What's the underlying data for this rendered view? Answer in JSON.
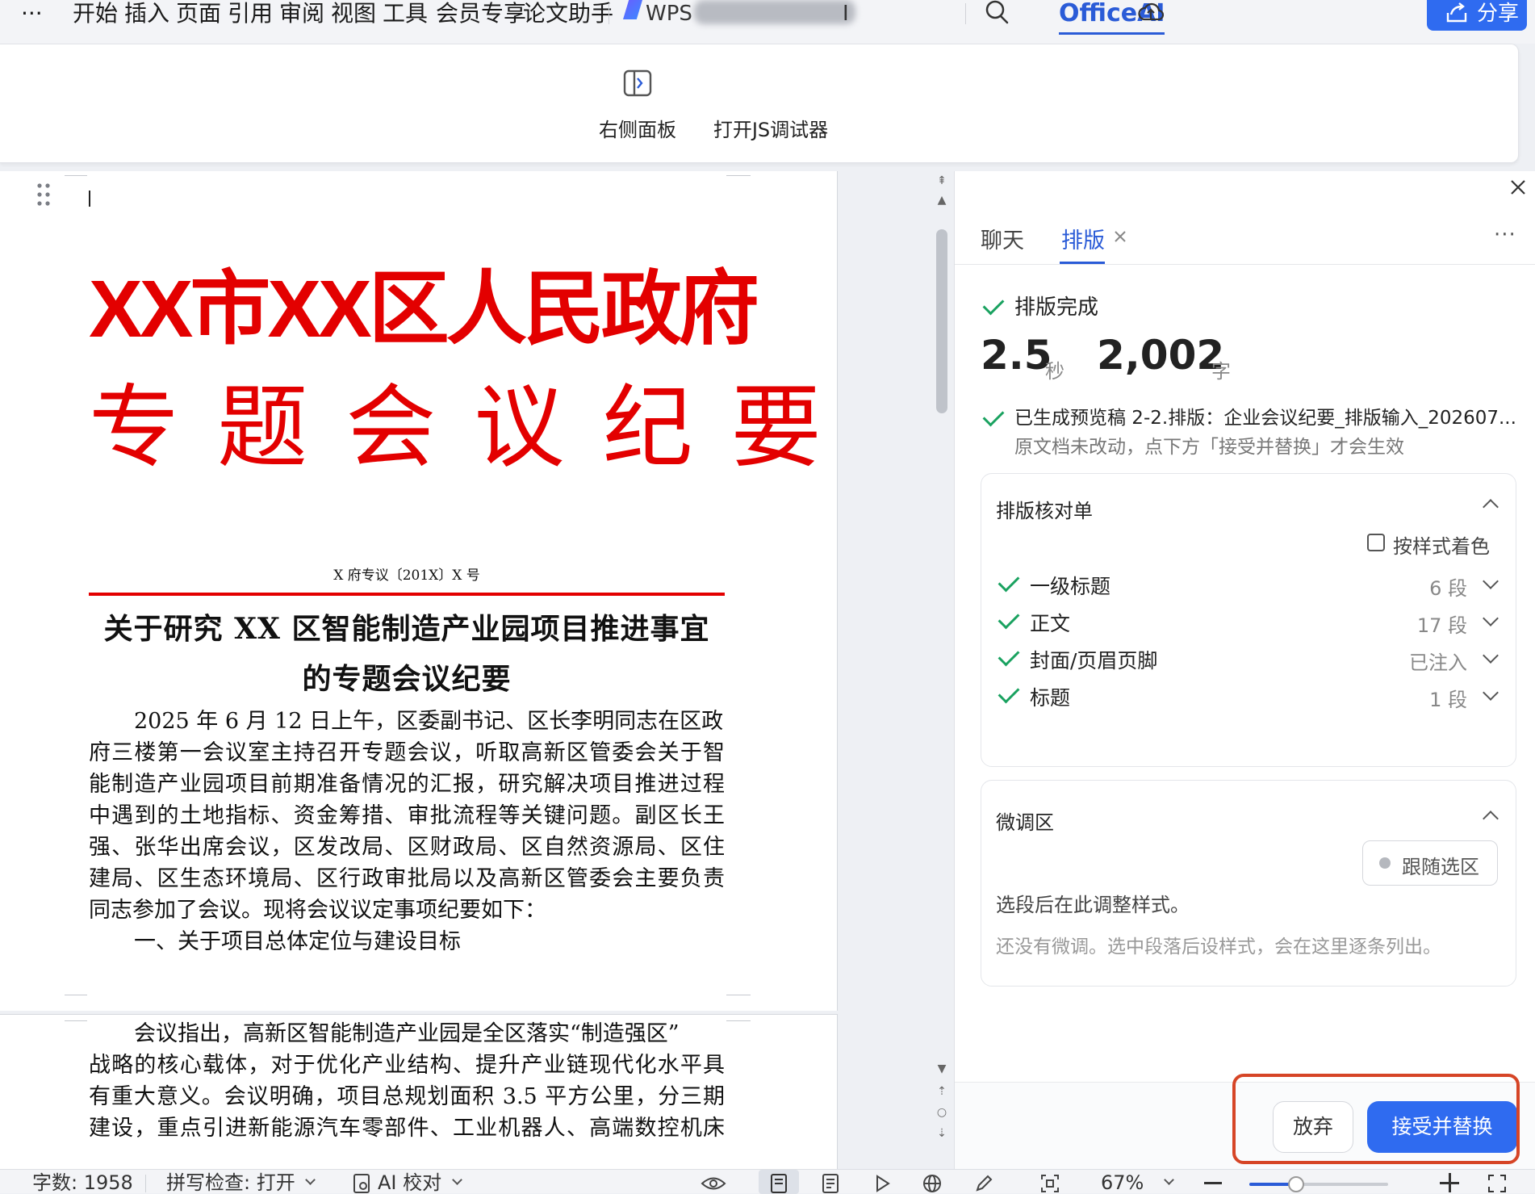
{
  "menubar": {
    "more_label": "···",
    "items": [
      "开始",
      "插入",
      "页面",
      "引用",
      "审阅",
      "视图",
      "工具",
      "会员专享",
      "论文助手"
    ],
    "brand_partial_left": "WPS",
    "brand_partial_right": "I",
    "officeai_tab": "OfficeAI",
    "share_label": "分享"
  },
  "ribbon": {
    "right_panel_label": "右侧面板",
    "js_debugger_label": "打开JS调试器"
  },
  "document": {
    "title_line1": "XX市XX区人民政府",
    "title_line2": "专 题 会 议 纪 要",
    "doc_number": "X 府专议〔201X〕X 号",
    "heading_line1": "关于研究 XX 区智能制造产业园项目推进事宜",
    "heading_line2": "的专题会议纪要",
    "para1": [
      "2025 年 6 月 12 日上午，区委副书记、区长李明同志在区政",
      "府三楼第一会议室主持召开专题会议，听取高新区管委会关于智",
      "能制造产业园项目前期准备情况的汇报，研究解决项目推进过程",
      "中遇到的土地指标、资金筹措、审批流程等关键问题。副区长王",
      "强、张华出席会议，区发改局、区财政局、区自然资源局、区住",
      "建局、区生态环境局、区行政审批局以及高新区管委会主要负责",
      "同志参加了会议。现将会议议定事项纪要如下："
    ],
    "section1": "一、关于项目总体定位与建设目标",
    "para2": [
      "会议指出，高新区智能制造产业园是全区落实“制造强区”",
      "战略的核心载体，对于优化产业结构、提升产业链现代化水平具",
      "有重大意义。会议明确，项目总规划面积 3.5 平方公里，分三期",
      "建设，重点引进新能源汽车零部件、工业机器人、高端数控机床"
    ]
  },
  "panel": {
    "tabs": {
      "chat": "聊天",
      "layout": "排版"
    },
    "status_done": "排版完成",
    "stat_seconds_value": "2.5",
    "stat_seconds_unit": "秒",
    "stat_chars_value": "2,002",
    "stat_chars_unit": "字",
    "preview_line1": "已生成预览稿 2-2.排版：企业会议纪要_排版输入_202607...",
    "preview_line2": "原文档未改动，点下方「接受并替换」才会生效",
    "checklist": {
      "title": "排版核对单",
      "color_by_style_label": "按样式着色",
      "color_by_style_checked": false,
      "rows": [
        {
          "label": "一级标题",
          "count": "6 段"
        },
        {
          "label": "正文",
          "count": "17 段"
        },
        {
          "label": "封面/页眉页脚",
          "count": "已注入"
        },
        {
          "label": "标题",
          "count": "1 段"
        }
      ]
    },
    "finetune": {
      "title": "微调区",
      "follow_selection_label": "跟随选区",
      "hint": "选段后在此调整样式。",
      "empty": "还没有微调。选中段落后设样式，会在这里逐条列出。"
    },
    "discard_label": "放弃",
    "accept_label": "接受并替换"
  },
  "statusbar": {
    "word_count": "字数: 1958",
    "spellcheck": "拼写检查: 打开",
    "ai_proof": "AI 校对",
    "zoom": "67%",
    "zoom_level": 0.34
  },
  "colors": {
    "accent_blue": "#2f6bf0",
    "doc_red": "#e30000",
    "check_green": "#1aa260",
    "highlight_red": "#d64526"
  }
}
